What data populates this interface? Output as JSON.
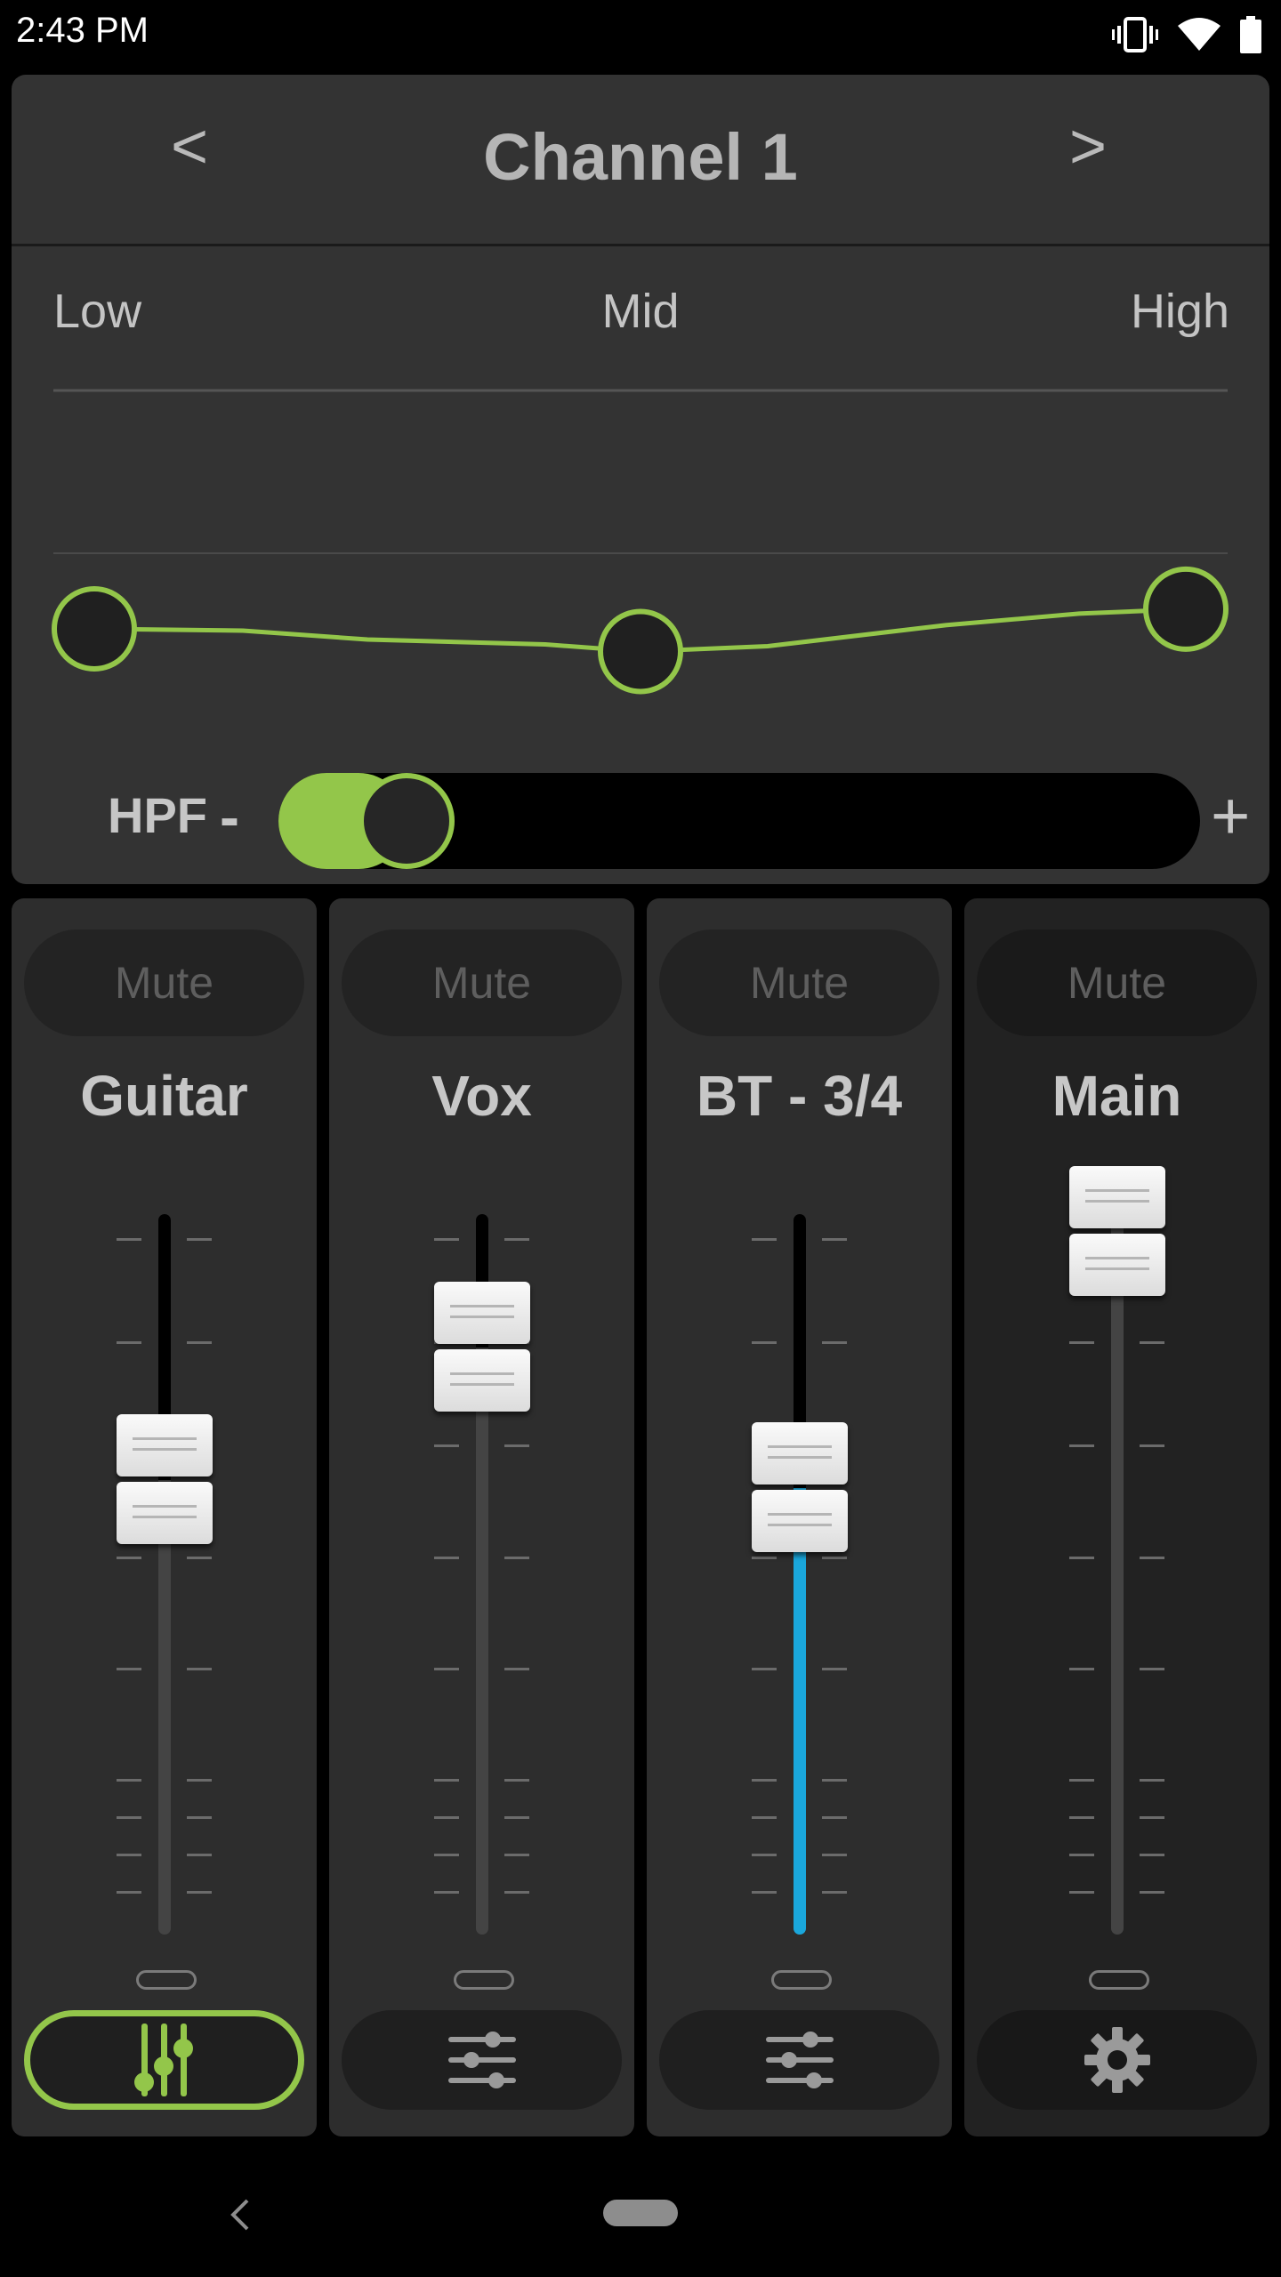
{
  "status_bar": {
    "time": "2:43 PM",
    "icons": [
      "vibrate-icon",
      "wifi-icon",
      "battery-icon"
    ]
  },
  "channel": {
    "title": "Channel 1",
    "prev_label": "<",
    "next_label": ">",
    "eq": {
      "low_label": "Low",
      "mid_label": "Mid",
      "high_label": "High",
      "low_level": 0.0,
      "mid_level": -0.15,
      "high_level": 0.13
    },
    "hpf": {
      "label": "HPF",
      "minus_label": "-",
      "plus_label": "+",
      "value": 0.0
    }
  },
  "strips": [
    {
      "name": "Guitar",
      "mute_label": "Mute",
      "level": 0.655,
      "meter": 0,
      "button_icon": "mixer-sliders-icon",
      "active": true
    },
    {
      "name": "Vox",
      "mute_label": "Mute",
      "level": 0.84,
      "meter": 0,
      "button_icon": "sliders-icon",
      "active": false
    },
    {
      "name": "BT - 3/4",
      "mute_label": "Mute",
      "level": 0.645,
      "meter": 1,
      "button_icon": "sliders-icon",
      "active": false
    },
    {
      "name": "Main",
      "mute_label": "Mute",
      "level": 1.0,
      "meter": 0,
      "button_icon": "gear-icon",
      "active": false
    }
  ],
  "colors": {
    "accent": "#93c64a",
    "meter": "#1aa7dc",
    "panel": "#333333"
  }
}
